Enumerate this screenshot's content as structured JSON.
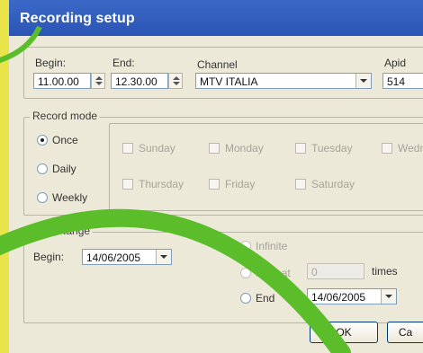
{
  "window": {
    "title": "Recording setup"
  },
  "top": {
    "begin_label": "Begin:",
    "begin_value": "11.00.00",
    "end_label": "End:",
    "end_value": "12.30.00",
    "channel_label": "Channel",
    "channel_value": "MTV ITALIA",
    "apid_label": "Apid",
    "apid_value": "514"
  },
  "record_mode": {
    "legend": "Record mode",
    "radios": [
      {
        "label": "Once",
        "checked": true
      },
      {
        "label": "Daily",
        "checked": false
      },
      {
        "label": "Weekly",
        "checked": false
      }
    ],
    "days": [
      "Sunday",
      "Monday",
      "Tuesday",
      "Wedne",
      "Thursday",
      "Friday",
      "Saturday"
    ]
  },
  "date_range": {
    "legend": "Date Range",
    "begin_label": "Begin:",
    "begin_value": "14/06/2005",
    "infinite_label": "Infinite",
    "repeat_label": "Repeat",
    "repeat_value": "0",
    "times_label": "times",
    "end_label": "End",
    "end_value": "14/06/2005"
  },
  "buttons": {
    "ok": "OK",
    "cancel": "Ca"
  },
  "colors": {
    "titlebar": "#2b55b5",
    "accent_green": "#5bbd2a",
    "accent_yellow": "#e9e44a"
  }
}
